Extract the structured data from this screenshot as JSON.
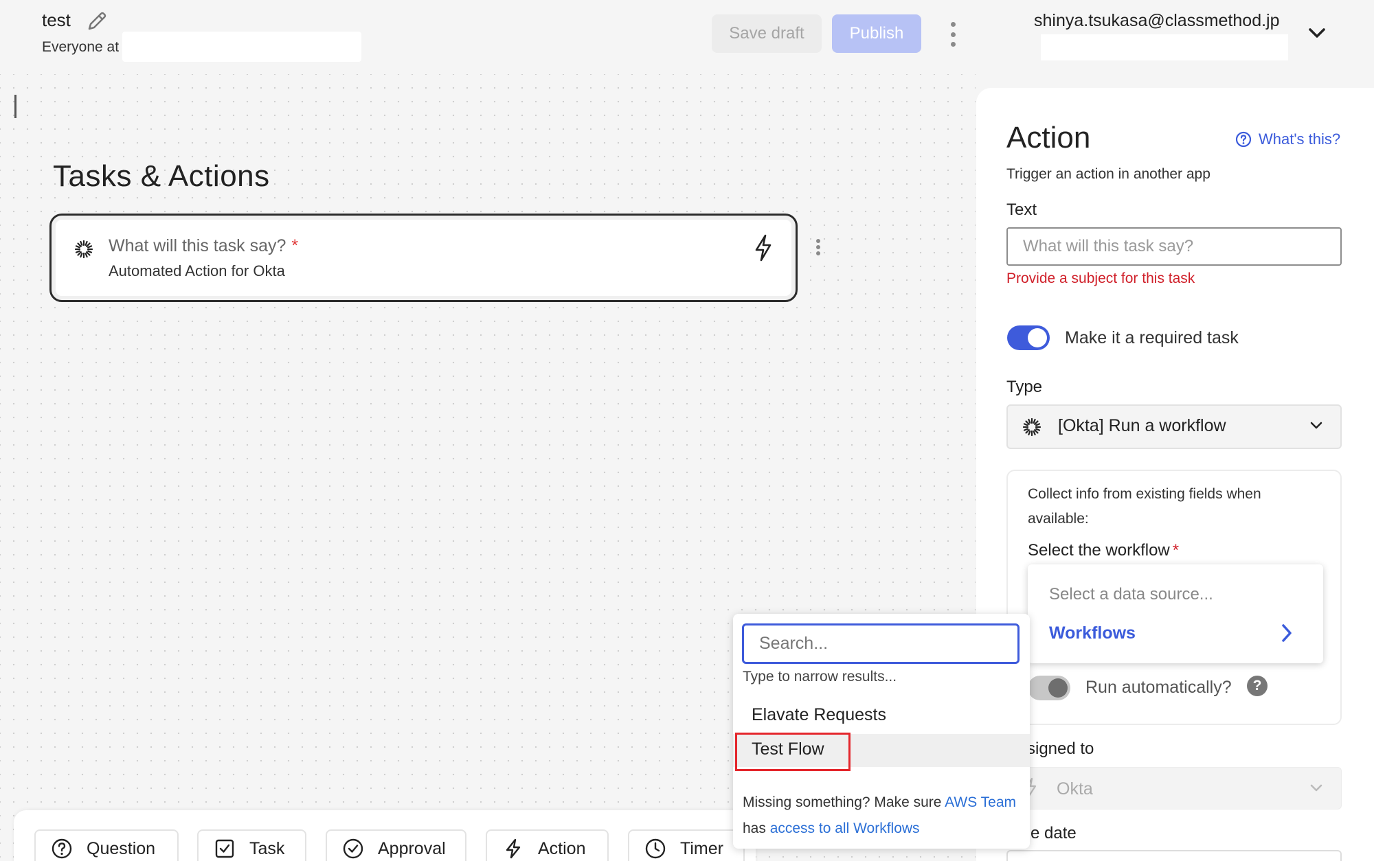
{
  "header": {
    "doc_title": "test",
    "audience": "Everyone at",
    "save_draft_label": "Save draft",
    "publish_label": "Publish",
    "user_email": "shinya.tsukasa@classmethod.jp"
  },
  "canvas": {
    "section_title": "Tasks & Actions",
    "task": {
      "title": "What will this task say?",
      "required_mark": "*",
      "subtitle": "Automated Action for Okta"
    }
  },
  "panel": {
    "title": "Action",
    "whats_this": "What's this?",
    "subtitle": "Trigger an action in another app",
    "text_label": "Text",
    "text_placeholder": "What will this task say?",
    "text_error": "Provide a subject for this task",
    "required_label": "Make it a required task",
    "type_label": "Type",
    "type_value": "[Okta] Run a workflow",
    "collect_text": "Collect info from existing fields when available:",
    "workflow_label": "Select the workflow",
    "required_mark": "*",
    "datasource_placeholder": "Select a data source...",
    "datasource_option": "Workflows",
    "run_auto_label": "Run automatically?",
    "run_auto_help": "?",
    "assigned_label": "signed to",
    "assigned_value": "Okta",
    "due_label": "e date"
  },
  "workflow_dropdown": {
    "search_placeholder": "Search...",
    "hint": "Type to narrow results...",
    "items": [
      "Elavate Requests",
      "Test Flow"
    ],
    "missing_prefix": "Missing something? Make sure ",
    "missing_link1": "AWS Team",
    "missing_mid": " has ",
    "missing_link2": "access to all Workflows"
  },
  "toolbar": {
    "question": "Question",
    "task": "Task",
    "approval": "Approval",
    "action": "Action",
    "timer": "Timer"
  },
  "colors": {
    "accent": "#3e5bdb",
    "error": "#d0202a",
    "highlight": "#e4262c"
  }
}
